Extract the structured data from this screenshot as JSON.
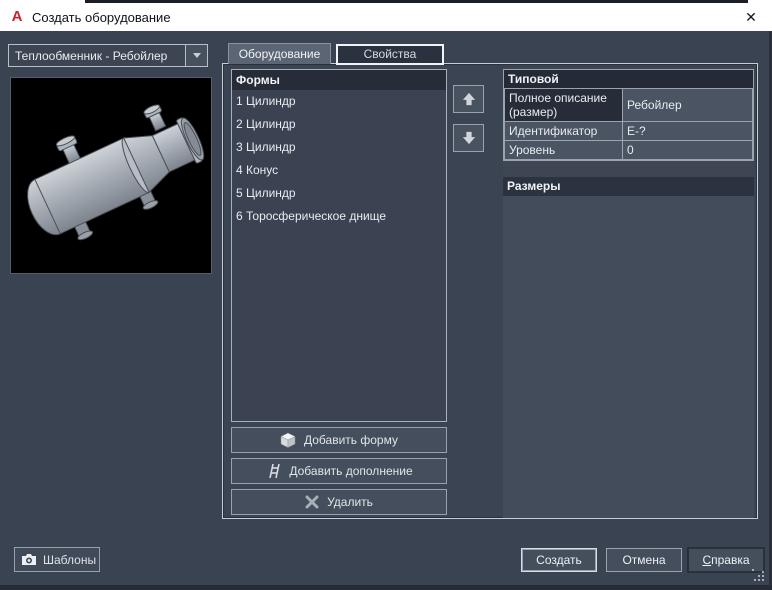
{
  "window": {
    "title": "Создать оборудование",
    "close_glyph": "✕",
    "logo_letter": "A"
  },
  "top": {
    "equipment_type": "Теплообменник - Ребойлер"
  },
  "tabs": {
    "equipment": "Оборудование",
    "properties": "Свойства"
  },
  "shapes": {
    "header": "Формы",
    "items": [
      "1 Цилиндр",
      "2 Цилиндр",
      "3 Цилиндр",
      "4 Конус",
      "5 Цилиндр",
      "6 Торосферическое днище"
    ]
  },
  "shape_actions": {
    "add_shape": "Добавить форму",
    "add_attachment": "Добавить дополнение",
    "delete": "Удалить"
  },
  "properties": {
    "general": {
      "header": "Типовой",
      "rows": [
        {
          "label": "Полное описание (размер)",
          "value": "Ребойлер"
        },
        {
          "label": "Идентификатор",
          "value": "E-?"
        },
        {
          "label": "Уровень",
          "value": "0"
        }
      ]
    },
    "dimensions": {
      "header": "Размеры"
    }
  },
  "footer": {
    "templates": "Шаблоны",
    "create": {
      "pre": "Соз",
      "accel": "д",
      "post": "ать"
    },
    "cancel": "Отмена",
    "help": {
      "pre": "",
      "accel": "С",
      "post": "правка"
    }
  },
  "colors": {
    "titlebar": "#ffffff",
    "dialog_bg": "#3a4352",
    "cell_bg": "#4a5462",
    "header_bg": "#252b36",
    "grid_line": "#9ca3ad",
    "logo_red": "#c5262c",
    "preview_bg": "#000000",
    "focus_outline": "#f2f4f6"
  }
}
